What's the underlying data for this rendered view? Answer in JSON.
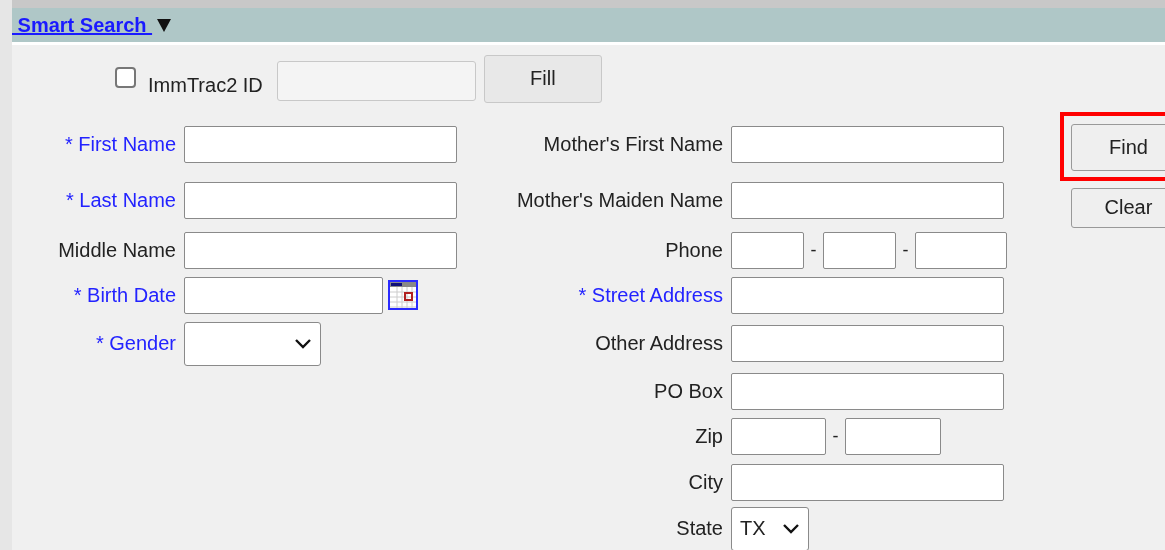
{
  "header": {
    "title": " Smart Search ",
    "expanded": true
  },
  "immtrac": {
    "label": "ImmTrac2 ID",
    "checked": false,
    "button": "Fill"
  },
  "left_fields": [
    {
      "label": "* First Name",
      "required": true,
      "kind": "text"
    },
    {
      "label": "* Last Name",
      "required": true,
      "kind": "text"
    },
    {
      "label": "Middle Name",
      "required": false,
      "kind": "text"
    },
    {
      "label": "* Birth Date",
      "required": true,
      "kind": "date"
    },
    {
      "label": "* Gender",
      "required": true,
      "kind": "select"
    }
  ],
  "right_fields": [
    {
      "label": "Mother's First Name",
      "required": false,
      "kind": "text"
    },
    {
      "label": "Mother's Maiden Name",
      "required": false,
      "kind": "text"
    },
    {
      "label": "Phone",
      "required": false,
      "kind": "phone",
      "separators": [
        "-",
        "-"
      ]
    },
    {
      "label": "* Street Address",
      "required": true,
      "kind": "text"
    },
    {
      "label": "Other Address",
      "required": false,
      "kind": "text"
    },
    {
      "label": "PO Box",
      "required": false,
      "kind": "text"
    },
    {
      "label": "Zip",
      "required": false,
      "kind": "zip",
      "separators": [
        "-"
      ]
    },
    {
      "label": "City",
      "required": false,
      "kind": "text"
    },
    {
      "label": "State",
      "required": false,
      "kind": "select",
      "value": "TX"
    }
  ],
  "buttons": [
    {
      "label": "Find",
      "highlighted": true
    },
    {
      "label": "Clear",
      "highlighted": false
    }
  ]
}
